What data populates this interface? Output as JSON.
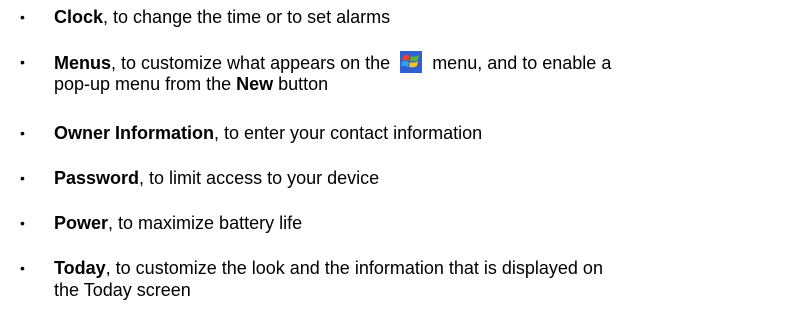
{
  "items": [
    {
      "bullet": "•",
      "term": "Clock",
      "rest": ", to change the time or to set alarms"
    },
    {
      "bullet": "•",
      "term": "Menus",
      "rest_a": ", to customize what appears on the ",
      "rest_b": " menu, and to enable a",
      "line2_a": "pop-up menu from the ",
      "line2_bold": "New",
      "line2_b": " button"
    },
    {
      "bullet": "•",
      "term": "Owner Information",
      "rest": ", to enter your contact information"
    },
    {
      "bullet": "•",
      "term": "Password",
      "rest": ", to limit access to your device"
    },
    {
      "bullet": "•",
      "term": "Power",
      "rest": ", to maximize battery life"
    },
    {
      "bullet": "•",
      "term": "Today",
      "rest": ", to customize the look and the information that is displayed on",
      "line2": "the Today screen"
    }
  ],
  "icons": {
    "start_menu": "windows-flag-icon"
  }
}
